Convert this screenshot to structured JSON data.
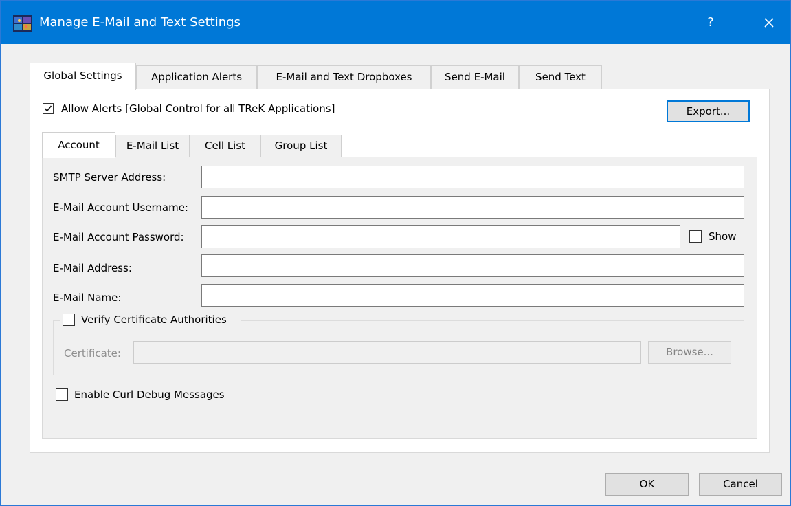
{
  "window": {
    "title": "Manage E-Mail and Text Settings",
    "help_glyph": "?",
    "app_icon": "trek-app-icon",
    "close_icon": "close-x-icon",
    "accent_color": "#0078d7"
  },
  "main_tabs": [
    {
      "label": "Global Settings",
      "active": true
    },
    {
      "label": "Application Alerts",
      "active": false
    },
    {
      "label": "E-Mail and Text Dropboxes",
      "active": false
    },
    {
      "label": "Send E-Mail",
      "active": false
    },
    {
      "label": "Send Text",
      "active": false
    }
  ],
  "global": {
    "allow_alerts_label": "Allow Alerts [Global Control for all TReK  Applications]",
    "allow_alerts_checked": true,
    "export_label": "Export..."
  },
  "sub_tabs": [
    {
      "label": "Account",
      "active": true
    },
    {
      "label": "E-Mail List",
      "active": false
    },
    {
      "label": "Cell List",
      "active": false
    },
    {
      "label": "Group List",
      "active": false
    }
  ],
  "account": {
    "smtp_label": "SMTP Server Address:",
    "smtp_value": "",
    "username_label": "E-Mail Account Username:",
    "username_value": "",
    "password_label": "E-Mail Account Password:",
    "password_value": "",
    "show_label": "Show",
    "show_checked": false,
    "address_label": "E-Mail Address:",
    "address_value": "",
    "name_label": "E-Mail Name:",
    "name_value": "",
    "verify_label": "Verify Certificate Authorities",
    "verify_checked": false,
    "certificate_label": "Certificate:",
    "certificate_value": "",
    "browse_label": "Browse...",
    "curl_debug_label": "Enable Curl Debug Messages",
    "curl_debug_checked": false
  },
  "footer": {
    "ok_label": "OK",
    "cancel_label": "Cancel"
  }
}
